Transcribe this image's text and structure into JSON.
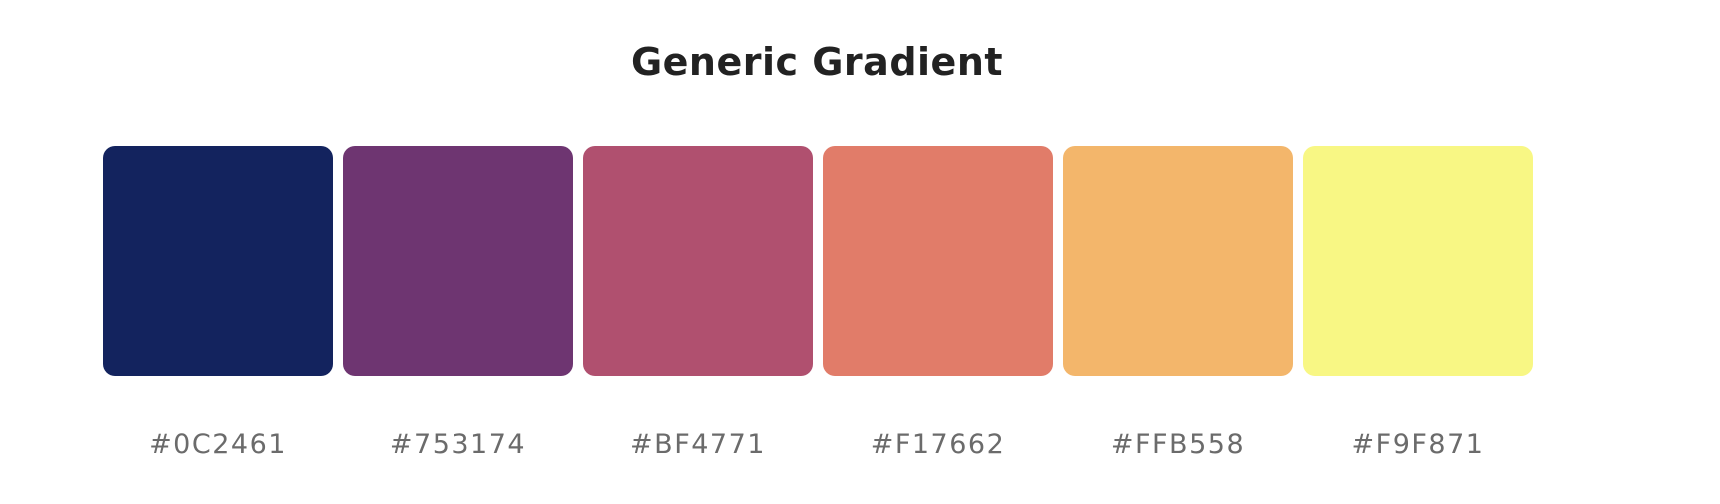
{
  "title": "Generic Gradient",
  "swatches": [
    {
      "color": "#13235E",
      "label": "#0C2461"
    },
    {
      "color": "#6E3571",
      "label": "#753174"
    },
    {
      "color": "#B0506F",
      "label": "#BF4771"
    },
    {
      "color": "#E17C69",
      "label": "#F17662"
    },
    {
      "color": "#F3B66B",
      "label": "#FFB558"
    },
    {
      "color": "#F8F784",
      "label": "#F9F871"
    }
  ]
}
